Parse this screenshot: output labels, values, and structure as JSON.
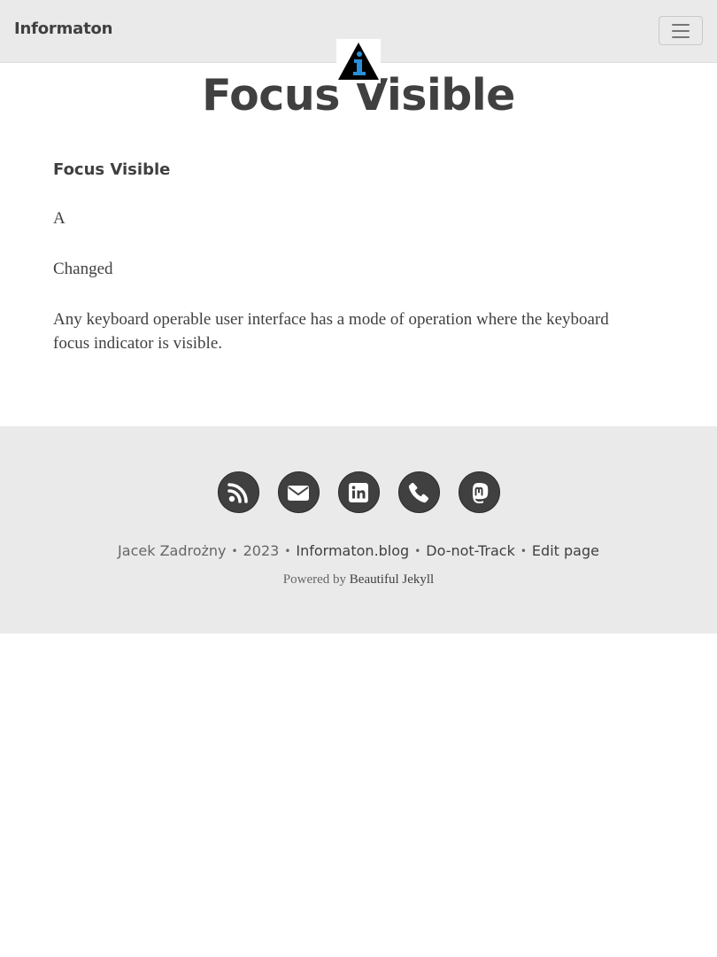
{
  "navbar": {
    "brand": "Informaton",
    "menu_icon": "hamburger-menu-icon"
  },
  "logo": {
    "icon": "info-triangle-logo",
    "letter": "i",
    "colors": {
      "triangle": "#000000",
      "letter": "#2a8fd8"
    }
  },
  "page": {
    "title": "Focus Visible"
  },
  "content": {
    "heading": "Focus Visible",
    "level": "A",
    "status": "Changed",
    "description": "Any keyboard operable user interface has a mode of operation where the keyboard focus indicator is visible."
  },
  "footer": {
    "social": [
      {
        "icon": "rss-icon"
      },
      {
        "icon": "envelope-icon"
      },
      {
        "icon": "linkedin-icon"
      },
      {
        "icon": "phone-icon"
      },
      {
        "icon": "mastodon-icon"
      }
    ],
    "author": "Jacek Zadrożny",
    "separator": "•",
    "year": "2023",
    "links": [
      "Informaton.blog",
      "Do-not-Track",
      "Edit page"
    ],
    "powered_prefix": "Powered by",
    "powered_link": "Beautiful Jekyll"
  },
  "colors": {
    "navbar_bg": "#eaeaea",
    "footer_bg": "#eaeaea",
    "text": "#404040",
    "icon_circle": "#404040"
  }
}
